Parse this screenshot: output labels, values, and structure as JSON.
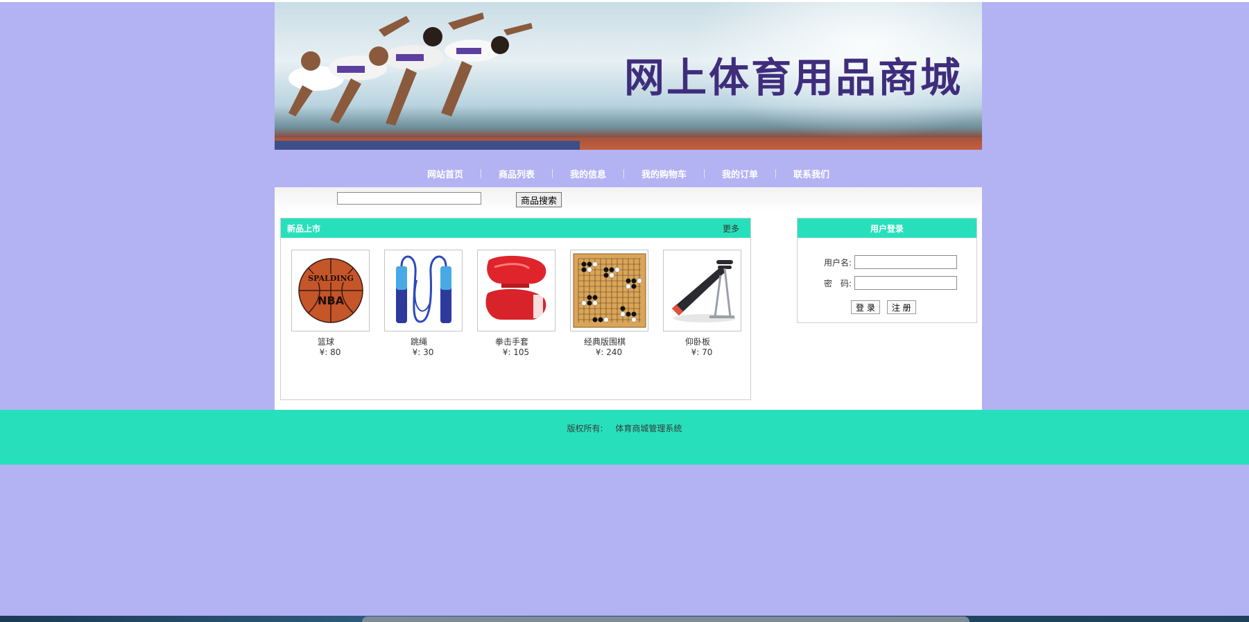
{
  "banner": {
    "title": "网上体育用品商城"
  },
  "nav": {
    "items": [
      "网站首页",
      "商品列表",
      "我的信息",
      "我的购物车",
      "我的订单",
      "联系我们"
    ]
  },
  "search": {
    "value": "",
    "button_label": "商品搜索"
  },
  "new_products": {
    "title": "新品上市",
    "more_label": "更多",
    "items": [
      {
        "name": "篮球",
        "price": "¥: 80",
        "icon": "basketball-icon"
      },
      {
        "name": "跳绳",
        "price": "¥: 30",
        "icon": "jump-rope-icon"
      },
      {
        "name": "拳击手套",
        "price": "¥: 105",
        "icon": "boxing-gloves-icon"
      },
      {
        "name": "经典版围棋",
        "price": "¥: 240",
        "icon": "go-board-icon"
      },
      {
        "name": "仰卧板",
        "price": "¥: 70",
        "icon": "sit-up-bench-icon"
      }
    ]
  },
  "login": {
    "title": "用户登录",
    "username_label": "用户名:",
    "password_label": "密　码:",
    "username_value": "",
    "password_value": "",
    "login_button": "登 录",
    "register_button": "注 册"
  },
  "footer": {
    "copyright_label": "版权所有:",
    "owner": "体育商城管理系统"
  },
  "colors": {
    "page_bg": "#b3b2f3",
    "accent": "#27e0bb",
    "title_purple": "#3f2d7c"
  }
}
